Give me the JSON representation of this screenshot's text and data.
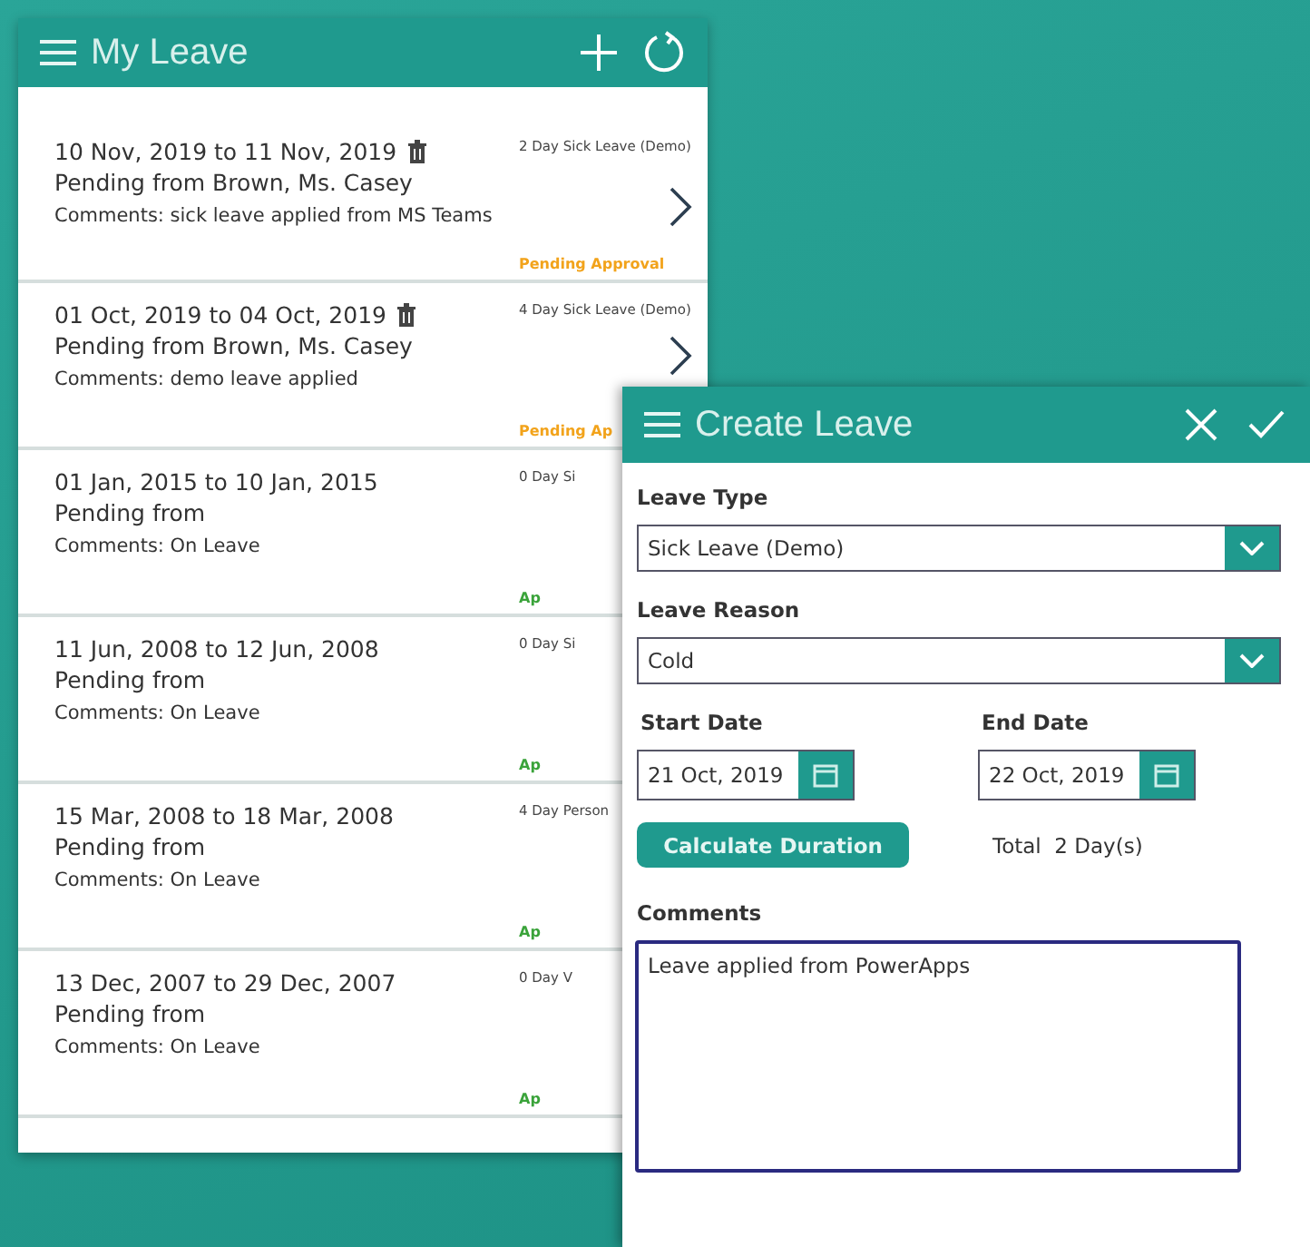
{
  "list_window": {
    "title": "My Leave",
    "rows": [
      {
        "dates": "10 Nov, 2019 to 11 Nov, 2019",
        "has_delete": true,
        "pending": "Pending from Brown, Ms. Casey",
        "comments": "Comments: sick leave applied from MS Teams",
        "type": "2 Day Sick Leave (Demo)",
        "status": "Pending Approval",
        "color": "#f2a31b",
        "has_chevron": true
      },
      {
        "dates": "01 Oct, 2019 to 04 Oct, 2019",
        "has_delete": true,
        "pending": "Pending from Brown, Ms. Casey",
        "comments": "Comments: demo leave applied",
        "type": "4 Day Sick Leave (Demo)",
        "status": "Pending Ap",
        "color": "#f2a31b",
        "has_chevron": true
      },
      {
        "dates": "01 Jan, 2015 to 10 Jan, 2015",
        "has_delete": false,
        "pending": "Pending from",
        "comments": "Comments: On Leave",
        "type": "0 Day Si",
        "status": "Ap",
        "color": "#3aa33a"
      },
      {
        "dates": "11 Jun, 2008 to 12 Jun, 2008",
        "has_delete": false,
        "pending": "Pending from",
        "comments": "Comments: On Leave",
        "type": "0 Day Si",
        "status": "Ap",
        "color": "#3aa33a"
      },
      {
        "dates": "15 Mar, 2008 to 18 Mar, 2008",
        "has_delete": false,
        "pending": "Pending from",
        "comments": "Comments: On Leave",
        "type": "4 Day Person",
        "status": "Ap",
        "color": "#3aa33a"
      },
      {
        "dates": "13 Dec, 2007 to 29 Dec, 2007",
        "has_delete": false,
        "pending": "Pending from",
        "comments": "Comments: On Leave",
        "type": "0 Day V",
        "status": "Ap",
        "color": "#3aa33a"
      }
    ]
  },
  "create_window": {
    "title": "Create Leave",
    "leave_type": {
      "label": "Leave Type",
      "value": "Sick Leave (Demo)"
    },
    "leave_reason": {
      "label": "Leave Reason",
      "value": "Cold"
    },
    "start_date": {
      "label": "Start Date",
      "value": "21 Oct, 2019"
    },
    "end_date": {
      "label": "End Date",
      "value": "22 Oct, 2019"
    },
    "calculate_button": "Calculate Duration",
    "total": "Total  2 Day(s)",
    "comments": {
      "label": "Comments",
      "value": "Leave applied from PowerApps"
    }
  }
}
